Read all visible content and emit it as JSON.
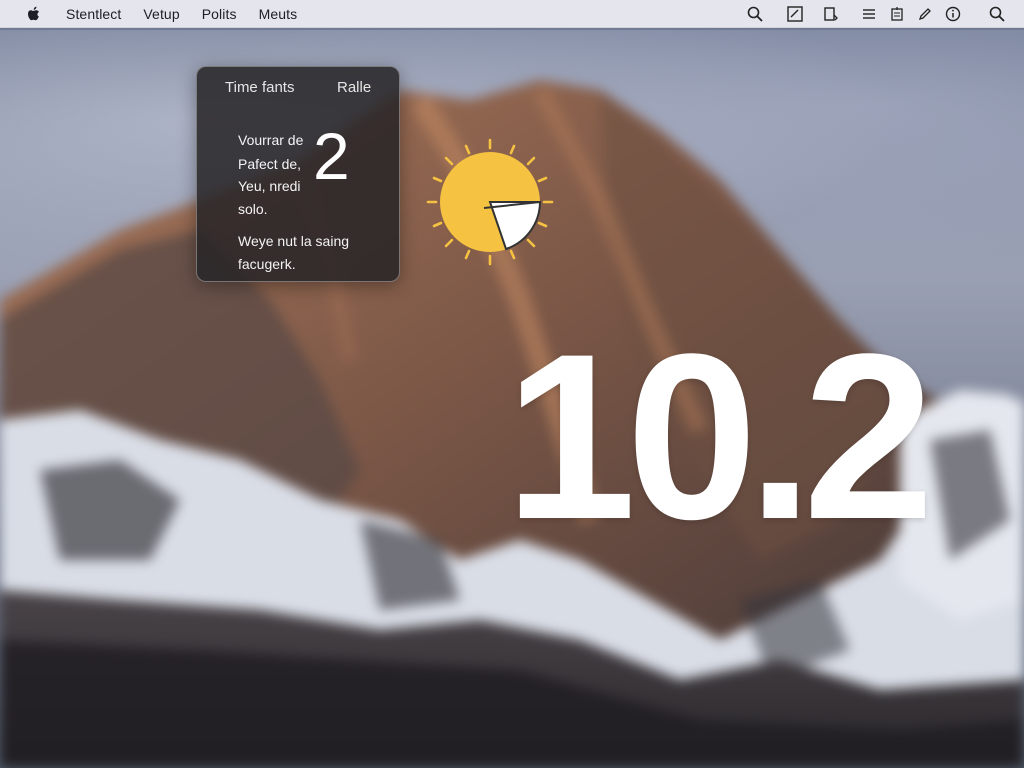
{
  "menubar": {
    "app_name": "Stentlect",
    "menus": [
      "Vetup",
      "Polits",
      "Meuts"
    ],
    "status_icons": [
      "search-icon",
      "note-icon",
      "clipboard-icon",
      "list-icon",
      "doc-icon",
      "pen-icon",
      "info-icon",
      "spotlight-icon"
    ]
  },
  "widget": {
    "tab_time": "Time fants",
    "tab_rate": "Ralle",
    "lines": [
      "Vourrar de",
      "Pafect de,",
      "Yeu, nredi",
      "solo.",
      "Weye nut la saing",
      "facugerk."
    ],
    "value": "2"
  },
  "weather": {
    "icon": "sun-icon",
    "sun_color": "#f5c242"
  },
  "version": "10.2"
}
